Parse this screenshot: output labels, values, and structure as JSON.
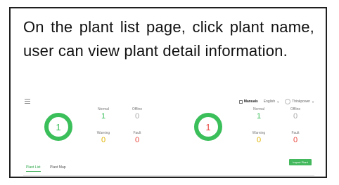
{
  "instruction": "On the plant list page, click plant name, user can view plant detail information.",
  "topbar": {
    "manual": "Manuals",
    "language": "English",
    "user": "Thinkpower"
  },
  "panels": [
    {
      "ring_value": "1",
      "normal": "1",
      "offline": "0",
      "warning": "0",
      "fault": "0"
    },
    {
      "ring_value": "1",
      "normal": "1",
      "offline": "0",
      "warning": "0",
      "fault": "0"
    }
  ],
  "labels": {
    "normal": "Normal",
    "offline": "Offline",
    "warning": "Warning",
    "fault": "Fault"
  },
  "tabs": [
    "Plant List",
    "Plant Map"
  ],
  "import_button": "Import Plant",
  "colors": {
    "accent": "#3bbf5a",
    "fault": "#e8453c",
    "warning": "#e0b300"
  }
}
